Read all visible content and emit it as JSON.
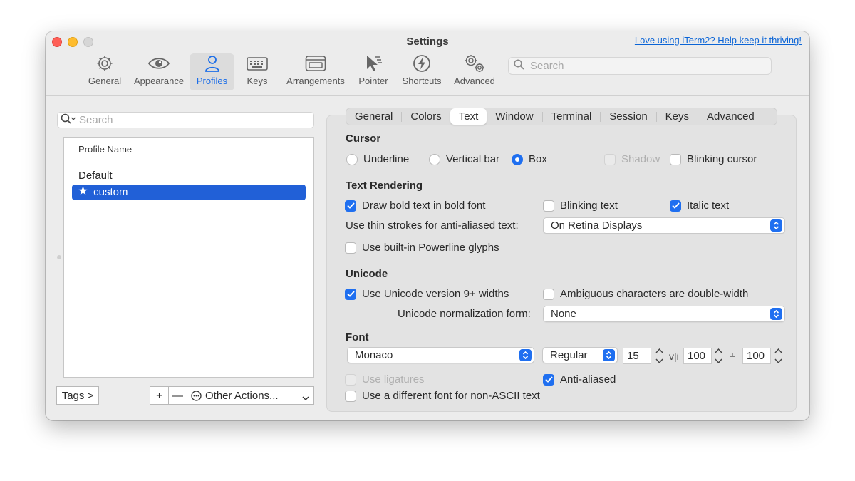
{
  "window": {
    "title": "Settings",
    "promo_link": "Love using iTerm2? Help keep it thriving!"
  },
  "toolbar": {
    "items": [
      {
        "label": "General",
        "icon": "gear-icon"
      },
      {
        "label": "Appearance",
        "icon": "eye-icon"
      },
      {
        "label": "Profiles",
        "icon": "person-icon",
        "active": true
      },
      {
        "label": "Keys",
        "icon": "keyboard-icon"
      },
      {
        "label": "Arrangements",
        "icon": "window-arrangement-icon"
      },
      {
        "label": "Pointer",
        "icon": "pointer-icon"
      },
      {
        "label": "Shortcuts",
        "icon": "lightning-icon"
      },
      {
        "label": "Advanced",
        "icon": "gears-icon"
      }
    ],
    "search_placeholder": "Search"
  },
  "profiles": {
    "search_placeholder": "Search",
    "column_header": "Profile Name",
    "items": [
      {
        "name": "Default"
      },
      {
        "name": "custom",
        "starred": true,
        "selected": true
      }
    ],
    "tags_button": "Tags >",
    "add_button": "+",
    "remove_button": "—",
    "other_actions": "Other Actions...",
    "other_actions_icon": "ellipsis-circle-icon"
  },
  "tabs": [
    "General",
    "Colors",
    "Text",
    "Window",
    "Terminal",
    "Session",
    "Keys",
    "Advanced"
  ],
  "active_tab": "Text",
  "cursor": {
    "title": "Cursor",
    "options": [
      {
        "label": "Underline",
        "selected": false
      },
      {
        "label": "Vertical bar",
        "selected": false
      },
      {
        "label": "Box",
        "selected": true
      }
    ],
    "shadow": {
      "label": "Shadow",
      "checked": false,
      "disabled": true
    },
    "blinking": {
      "label": "Blinking cursor",
      "checked": false
    }
  },
  "text_rendering": {
    "title": "Text Rendering",
    "bold": {
      "label": "Draw bold text in bold font",
      "checked": true
    },
    "blinking_text": {
      "label": "Blinking text",
      "checked": false
    },
    "italic": {
      "label": "Italic text",
      "checked": true
    },
    "thin_strokes_label": "Use thin strokes for anti-aliased text:",
    "thin_strokes_value": "On Retina Displays",
    "powerline": {
      "label": "Use built-in Powerline glyphs",
      "checked": false
    }
  },
  "unicode": {
    "title": "Unicode",
    "widths": {
      "label": "Use Unicode version 9+ widths",
      "checked": true
    },
    "ambiguous": {
      "label": "Ambiguous characters are double-width",
      "checked": false
    },
    "normalization_label": "Unicode normalization form:",
    "normalization_value": "None"
  },
  "font": {
    "title": "Font",
    "family": "Monaco",
    "weight": "Regular",
    "size": "15",
    "h_spacing": "100",
    "v_spacing": "100",
    "h_spacing_glyph": "v|i",
    "v_spacing_glyph": "⫨",
    "ligatures": {
      "label": "Use ligatures",
      "checked": false,
      "disabled": true
    },
    "anti_aliased": {
      "label": "Anti-aliased",
      "checked": true
    },
    "non_ascii": {
      "label": "Use a different font for non-ASCII text",
      "checked": false
    }
  },
  "colors": {
    "accent": "#1f6ff0",
    "selection": "#2160d7",
    "link": "#0a64d6"
  }
}
